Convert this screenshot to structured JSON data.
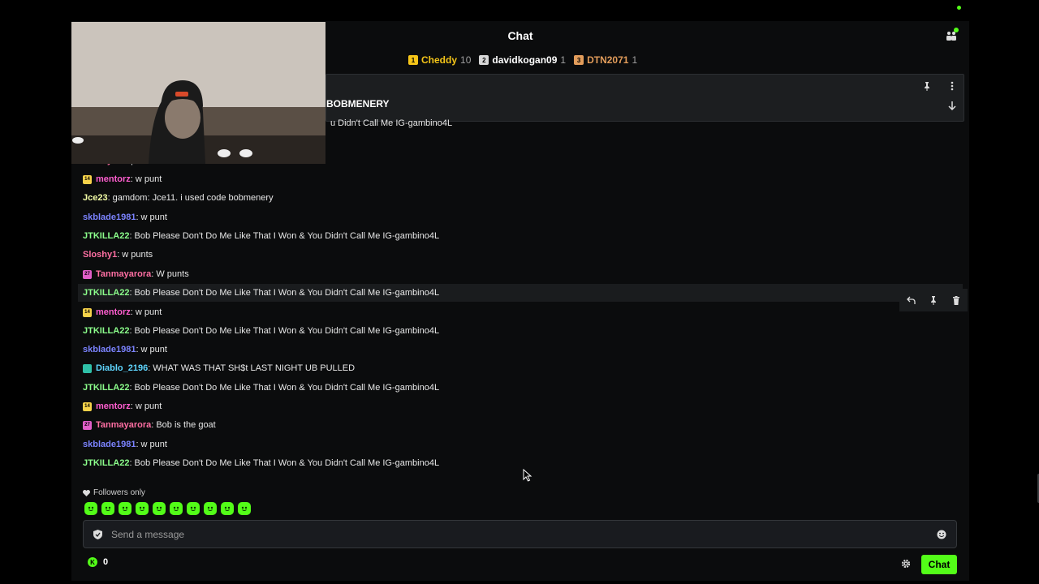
{
  "header": {
    "title": "Chat"
  },
  "leaderboard": [
    {
      "rank": "1",
      "name": "Cheddy",
      "count": "10",
      "rank_color": "#f5c518",
      "name_color": "#f5c518"
    },
    {
      "rank": "2",
      "name": "davidkogan09",
      "count": "1",
      "rank_color": "#d7d7d7",
      "name_color": "#ffffff"
    },
    {
      "rank": "3",
      "name": "DTN2071",
      "count": "1",
      "rank_color": "#e39d5b",
      "name_color": "#e39d5b"
    }
  ],
  "pinned": {
    "text": "BOBMENERY"
  },
  "messages": [
    {
      "user": "",
      "text": "u Didn't Call Me IG-gambino4L",
      "color": "#e8e8e8",
      "badge": "",
      "badge_color": ""
    },
    {
      "user": "Sloshy1",
      "text": "w punts",
      "color": "#ff6fa3",
      "badge": "",
      "badge_color": ""
    },
    {
      "user": "mentorz",
      "text": "w punt",
      "color": "#ff5ecf",
      "badge": "14",
      "badge_color": "#f6d24a"
    },
    {
      "user": "Jce23",
      "text": "gamdom: Jce11. i used code bobmenery",
      "color": "#f5ffa8",
      "badge": "",
      "badge_color": ""
    },
    {
      "user": "skblade1981",
      "text": "w punt",
      "color": "#7b83ff",
      "badge": "",
      "badge_color": ""
    },
    {
      "user": "JTKILLA22",
      "text": "Bob Please Don't Do Me Like That I Won & You Didn't Call Me IG-gambino4L",
      "color": "#8cff8c",
      "badge": "",
      "badge_color": ""
    },
    {
      "user": "Sloshy1",
      "text": "w punts",
      "color": "#ff6fa3",
      "badge": "",
      "badge_color": ""
    },
    {
      "user": "Tanmayarora",
      "text": "W punts",
      "color": "#ff6fa3",
      "badge": "27",
      "badge_color": "#e05ec8"
    },
    {
      "user": "JTKILLA22",
      "text": "Bob Please Don't Do Me Like That I Won & You Didn't Call Me IG-gambino4L",
      "color": "#8cff8c",
      "badge": "",
      "badge_color": ""
    },
    {
      "user": "mentorz",
      "text": "w punt",
      "color": "#ff5ecf",
      "badge": "14",
      "badge_color": "#f6d24a"
    },
    {
      "user": "JTKILLA22",
      "text": "Bob Please Don't Do Me Like That I Won & You Didn't Call Me IG-gambino4L",
      "color": "#8cff8c",
      "badge": "",
      "badge_color": ""
    },
    {
      "user": "skblade1981",
      "text": "w punt",
      "color": "#7b83ff",
      "badge": "",
      "badge_color": ""
    },
    {
      "user": "Diablo_2196",
      "text": "WHAT WAS THAT SH$t LAST NIGHT UB PULLED",
      "color": "#5fd6ff",
      "badge": "",
      "badge_color": "#2fc0a8"
    },
    {
      "user": "JTKILLA22",
      "text": "Bob Please Don't Do Me Like That I Won & You Didn't Call Me IG-gambino4L",
      "color": "#8cff8c",
      "badge": "",
      "badge_color": ""
    },
    {
      "user": "mentorz",
      "text": "w punt",
      "color": "#ff5ecf",
      "badge": "14",
      "badge_color": "#f6d24a"
    },
    {
      "user": "Tanmayarora",
      "text": "Bob is the goat",
      "color": "#ff6fa3",
      "badge": "27",
      "badge_color": "#e05ec8"
    },
    {
      "user": "skblade1981",
      "text": "w punt",
      "color": "#7b83ff",
      "badge": "",
      "badge_color": ""
    },
    {
      "user": "JTKILLA22",
      "text": "Bob Please Don't Do Me Like That I Won & You Didn't Call Me IG-gambino4L",
      "color": "#8cff8c",
      "badge": "",
      "badge_color": ""
    }
  ],
  "footer": {
    "followers_only": "Followers only",
    "input_placeholder": "Send a message",
    "points": "0",
    "chat_button": "Chat"
  },
  "colors": {
    "accent": "#53fc18",
    "background": "#0b0c0d"
  },
  "emotes": [
    "emote-1",
    "emote-2",
    "emote-3",
    "emote-4",
    "emote-5",
    "emote-6",
    "emote-7",
    "emote-8",
    "emote-9",
    "emote-10"
  ]
}
